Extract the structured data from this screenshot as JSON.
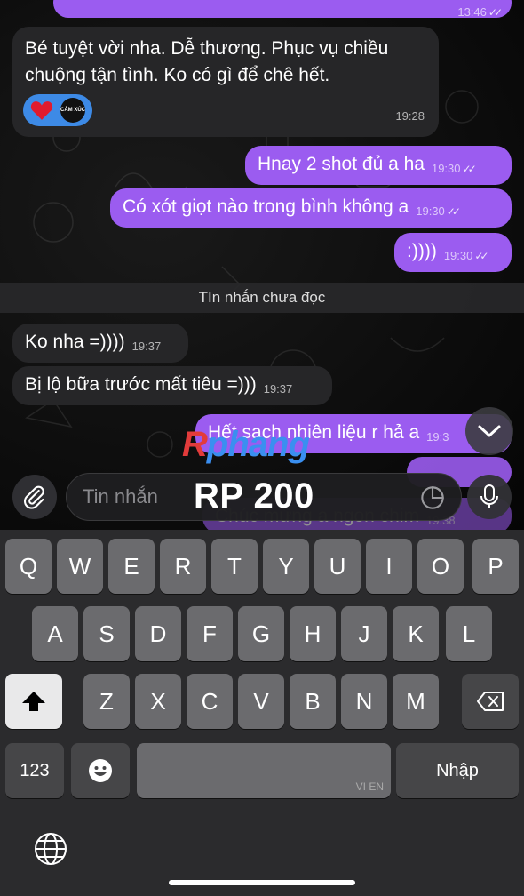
{
  "messages": {
    "m0": {
      "time": "13:46"
    },
    "m1": {
      "text": "Bé tuyệt vời nha. Dễ thương. Phục vụ chiều chuộng tận tình. Ko có gì để chê hết.",
      "time": "19:28",
      "reaction_chip": "CẢM XÚC"
    },
    "m2": {
      "text": "Hnay 2 shot đủ a ha",
      "time": "19:30"
    },
    "m3": {
      "text": "Có xót giọt nào trong bình không a",
      "time": "19:30"
    },
    "m4": {
      "text": ":))))",
      "time": "19:30"
    },
    "m5": {
      "text": "Ko nha =))))",
      "time": "19:37"
    },
    "m6": {
      "text": "Bị lộ bữa trước mất tiêu =)))",
      "time": "19:37"
    },
    "m7": {
      "text": "Hết sạch nhiên liệu r hả a",
      "time": "19:3"
    },
    "m8": {
      "text": "Chúc mừng a ngon chim",
      "time": "19:38"
    }
  },
  "unread_label": "TIn nhắn chưa đọc",
  "watermark": {
    "r": "R",
    "rest": "phang"
  },
  "price": "RP 200",
  "input": {
    "placeholder": "Tin nhắn"
  },
  "keyboard": {
    "row1": [
      "Q",
      "W",
      "E",
      "R",
      "T",
      "Y",
      "U",
      "I",
      "O",
      "P"
    ],
    "row2": [
      "A",
      "S",
      "D",
      "F",
      "G",
      "H",
      "J",
      "K",
      "L"
    ],
    "row3": [
      "Z",
      "X",
      "C",
      "V",
      "B",
      "N",
      "M"
    ],
    "numbers": "123",
    "return": "Nhập",
    "space_lang": "VI EN"
  },
  "colors": {
    "outgoing": "#9b5cf0",
    "incoming": "#262628",
    "reaction": "#3d8ae6"
  }
}
